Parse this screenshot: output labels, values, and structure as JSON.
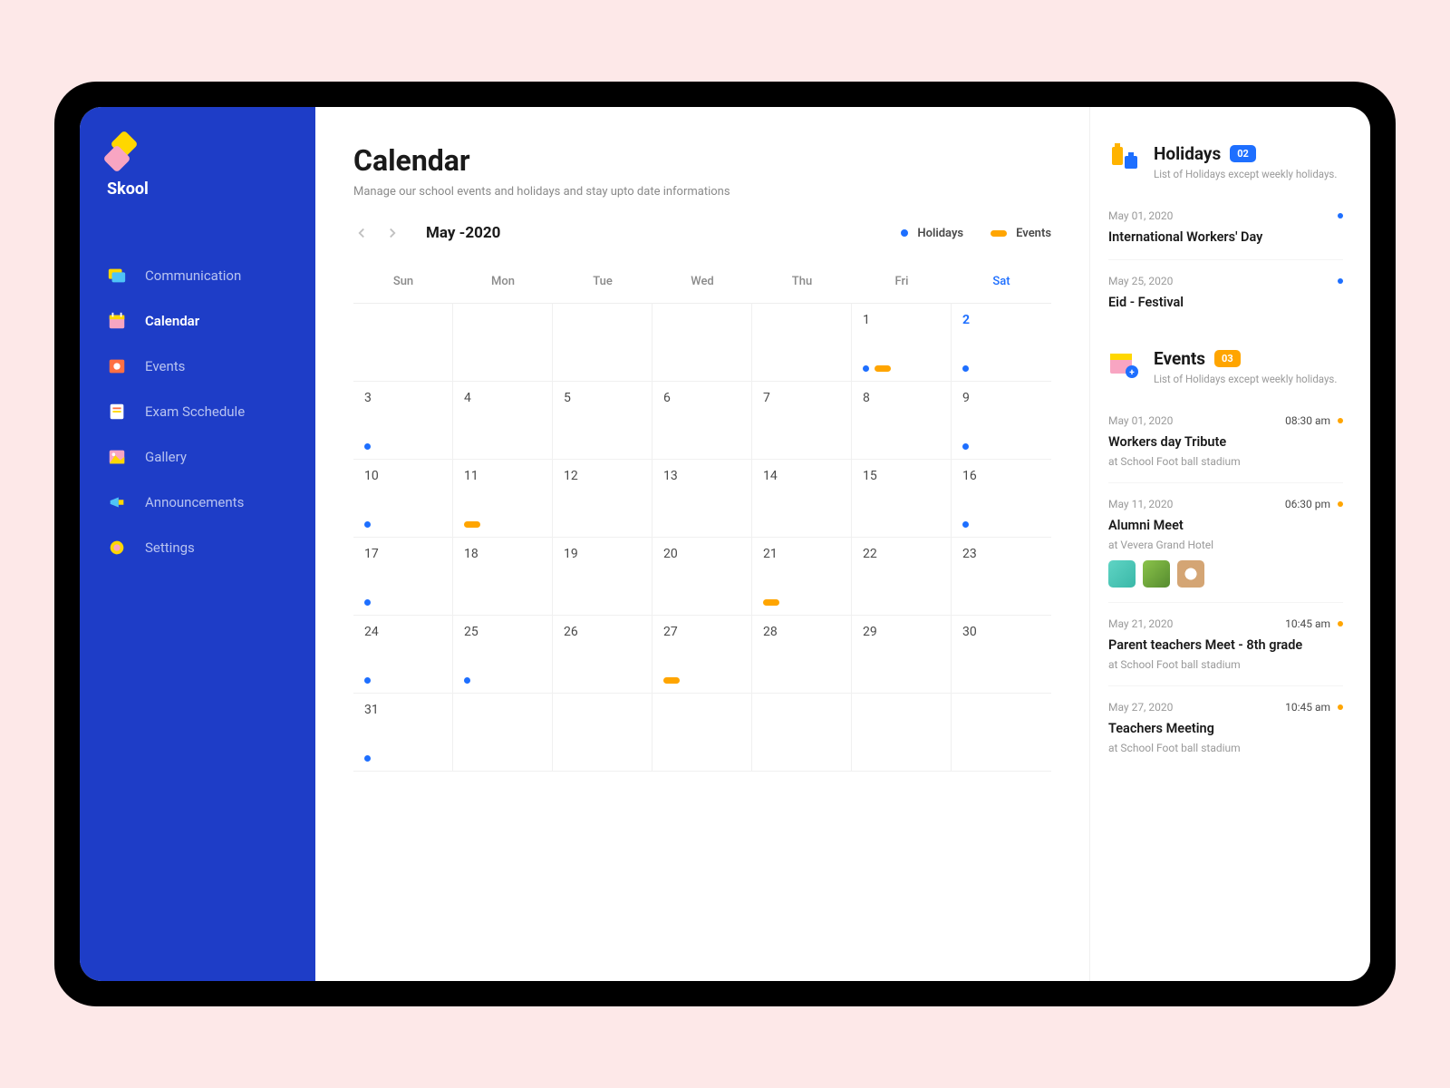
{
  "brand": "Skool",
  "sidebar": {
    "items": [
      {
        "label": "Communication"
      },
      {
        "label": "Calendar"
      },
      {
        "label": "Events"
      },
      {
        "label": "Exam Scchedule"
      },
      {
        "label": "Gallery"
      },
      {
        "label": "Announcements"
      },
      {
        "label": "Settings"
      }
    ]
  },
  "page": {
    "title": "Calendar",
    "subtitle": "Manage our school events and holidays  and stay upto date informations",
    "month": "May -2020"
  },
  "legend": {
    "holidays": "Holidays",
    "events": "Events"
  },
  "dayHeads": [
    "Sun",
    "Mon",
    "Tue",
    "Wed",
    "Thu",
    "Fri",
    "Sat"
  ],
  "calendar": [
    {
      "n": "",
      "marks": []
    },
    {
      "n": "",
      "marks": []
    },
    {
      "n": "",
      "marks": []
    },
    {
      "n": "",
      "marks": []
    },
    {
      "n": "",
      "marks": []
    },
    {
      "n": "1",
      "marks": [
        "dot",
        "bar"
      ]
    },
    {
      "n": "2",
      "blue": true,
      "marks": [
        "dot"
      ]
    },
    {
      "n": "3",
      "marks": [
        "dot"
      ]
    },
    {
      "n": "4",
      "marks": []
    },
    {
      "n": "5",
      "marks": []
    },
    {
      "n": "6",
      "marks": []
    },
    {
      "n": "7",
      "marks": []
    },
    {
      "n": "8",
      "marks": []
    },
    {
      "n": "9",
      "blue": false,
      "marks": [
        "dot"
      ]
    },
    {
      "n": "10",
      "marks": [
        "dot"
      ]
    },
    {
      "n": "11",
      "marks": [
        "bar"
      ]
    },
    {
      "n": "12",
      "marks": []
    },
    {
      "n": "13",
      "marks": []
    },
    {
      "n": "14",
      "marks": []
    },
    {
      "n": "15",
      "marks": []
    },
    {
      "n": "16",
      "marks": [
        "dot"
      ]
    },
    {
      "n": "17",
      "marks": [
        "dot"
      ]
    },
    {
      "n": "18",
      "marks": []
    },
    {
      "n": "19",
      "marks": []
    },
    {
      "n": "20",
      "marks": []
    },
    {
      "n": "21",
      "marks": [
        "bar"
      ]
    },
    {
      "n": "22",
      "marks": []
    },
    {
      "n": "23",
      "marks": []
    },
    {
      "n": "24",
      "marks": [
        "dot"
      ]
    },
    {
      "n": "25",
      "marks": [
        "dot"
      ]
    },
    {
      "n": "26",
      "marks": []
    },
    {
      "n": "27",
      "marks": [
        "bar"
      ]
    },
    {
      "n": "28",
      "marks": []
    },
    {
      "n": "29",
      "marks": []
    },
    {
      "n": "30",
      "marks": []
    },
    {
      "n": "31",
      "marks": [
        "dot"
      ]
    },
    {
      "n": "",
      "marks": []
    },
    {
      "n": "",
      "marks": []
    },
    {
      "n": "",
      "marks": []
    },
    {
      "n": "",
      "marks": []
    },
    {
      "n": "",
      "marks": []
    },
    {
      "n": "",
      "marks": []
    }
  ],
  "holidays": {
    "title": "Holidays",
    "count": "02",
    "sub": "List of Holidays except weekly holidays.",
    "items": [
      {
        "date": "May 01, 2020",
        "title": "International Workers' Day"
      },
      {
        "date": "May 25, 2020",
        "title": "Eid - Festival"
      }
    ]
  },
  "events": {
    "title": "Events",
    "count": "03",
    "sub": "List of Holidays except weekly holidays.",
    "items": [
      {
        "date": "May 01, 2020",
        "time": "08:30 am",
        "title": "Workers day Tribute",
        "loc": "at School Foot ball stadium"
      },
      {
        "date": "May 11, 2020",
        "time": "06:30 pm",
        "title": "Alumni Meet",
        "loc": "at Vevera Grand Hotel",
        "thumbs": true
      },
      {
        "date": "May 21, 2020",
        "time": "10:45 am",
        "title": "Parent teachers Meet - 8th grade",
        "loc": "at School Foot ball stadium"
      },
      {
        "date": "May 27, 2020",
        "time": "10:45 am",
        "title": "Teachers Meeting",
        "loc": "at School Foot ball stadium"
      }
    ]
  }
}
